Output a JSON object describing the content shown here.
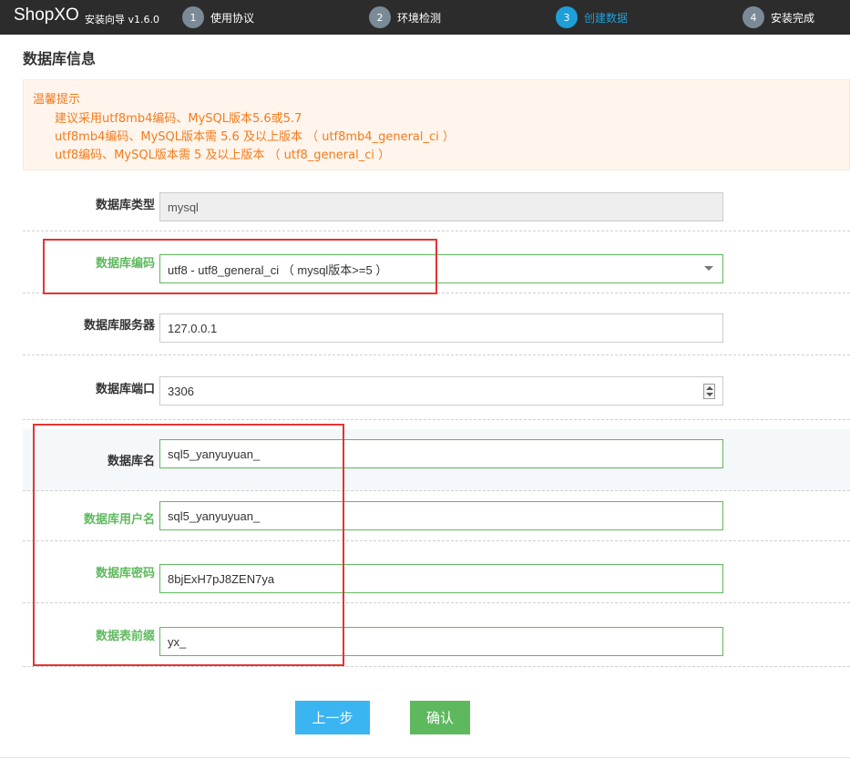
{
  "header": {
    "brand": "ShopXO",
    "subtitle": "安装向导 v1.6.0",
    "steps": [
      {
        "num": "1",
        "label": "使用协议"
      },
      {
        "num": "2",
        "label": "环境检测"
      },
      {
        "num": "3",
        "label": "创建数据"
      },
      {
        "num": "4",
        "label": "安装完成"
      }
    ],
    "active_step": 3
  },
  "page_title": "数据库信息",
  "tip": {
    "title": "温馨提示",
    "lines": [
      "建议采用utf8mb4编码、MySQL版本5.6或5.7",
      "utf8mb4编码、MySQL版本需 5.6 及以上版本 （ utf8mb4_general_ci ）",
      "utf8编码、MySQL版本需 5 及以上版本 （ utf8_general_ci ）"
    ]
  },
  "form": {
    "db_type": {
      "label": "数据库类型",
      "value": "mysql"
    },
    "db_charset": {
      "label": "数据库编码",
      "value": "utf8 - utf8_general_ci （ mysql版本>=5 ）"
    },
    "db_host": {
      "label": "数据库服务器",
      "value": "127.0.0.1"
    },
    "db_port": {
      "label": "数据库端口",
      "value": "3306"
    },
    "db_name": {
      "label": "数据库名",
      "value": "sql5_yanyuyuan_"
    },
    "db_user": {
      "label": "数据库用户名",
      "value": "sql5_yanyuyuan_"
    },
    "db_pass": {
      "label": "数据库密码",
      "value": "8bjExH7pJ8ZEN7ya"
    },
    "db_prefix": {
      "label": "数据表前缀",
      "value": "yx_"
    }
  },
  "buttons": {
    "prev": "上一步",
    "confirm": "确认"
  },
  "colors": {
    "header_bg": "#2c2c2c",
    "active_step": "#1e9fd8",
    "tip_text": "#f37b1d",
    "success": "#5eb95e",
    "primary": "#3bb4f2",
    "highlight": "#e53333"
  }
}
